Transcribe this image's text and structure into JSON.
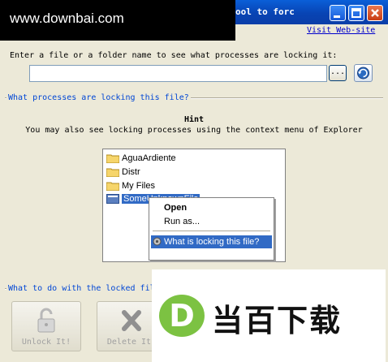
{
  "window": {
    "title": "ool to forc",
    "colors": {
      "titlebar": "#0a4fd0",
      "link": "#0000cc",
      "group_label": "#0046d5"
    }
  },
  "watermark_top": "www.downbai.com",
  "watermark_bottom": {
    "letter": "D",
    "text": "当百下载"
  },
  "link": {
    "visit": "Visit Web-site"
  },
  "file_prompt": "Enter a file or a folder name to see what processes are locking it:",
  "path_input": {
    "value": "",
    "placeholder": ""
  },
  "browse_label": "...",
  "processes_group": "What processes are locking this file?",
  "hint": {
    "title": "Hint",
    "text": "You may also see locking processes using the context menu of Explorer"
  },
  "explorer_demo": {
    "items": [
      "AguaArdiente",
      "Distr",
      "My Files",
      "SomeUnknownFile"
    ],
    "context_menu": [
      "Open",
      "Run as...",
      "What is locking this file?"
    ]
  },
  "actions_group": "What to do with the locked fil",
  "buttons": {
    "unlock": "Unlock It!",
    "delete": "Delete It!"
  },
  "icons": [
    "minimize-icon",
    "maximize-icon",
    "close-icon",
    "refresh-icon",
    "folder-icon",
    "file-icon",
    "gear-icon",
    "lock-icon",
    "delete-icon"
  ]
}
